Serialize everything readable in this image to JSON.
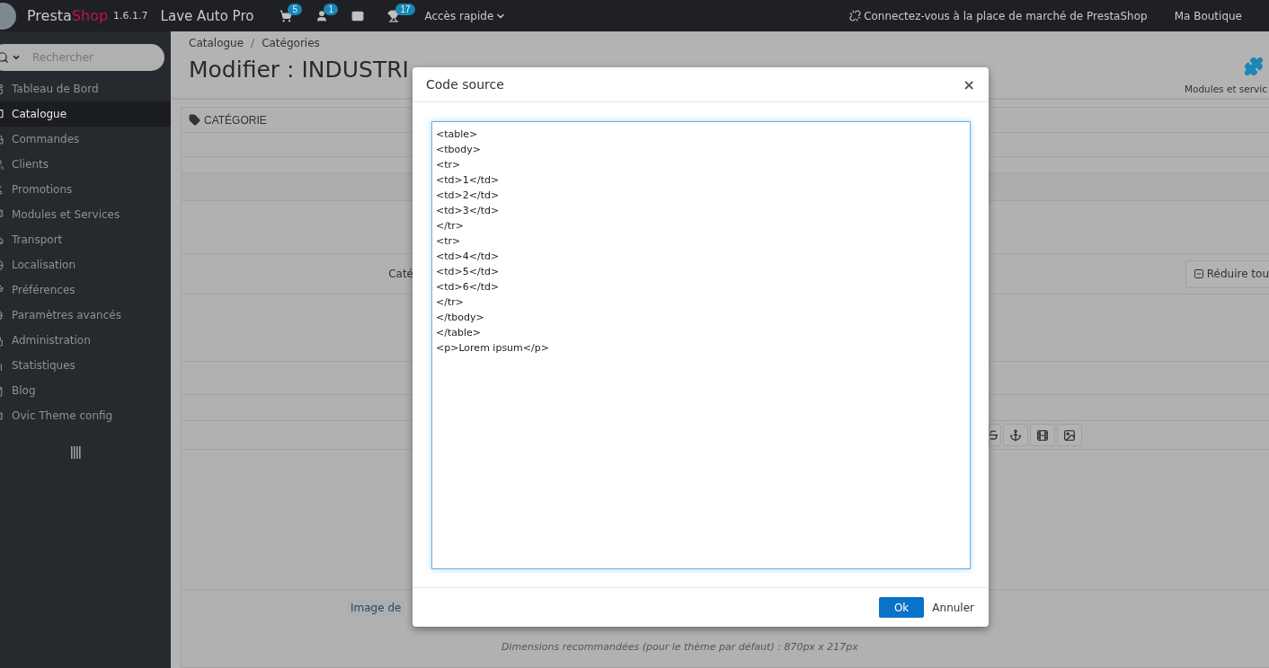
{
  "topbar": {
    "brand_main": "Presta",
    "brand_accent": "Shop",
    "version": "1.6.1.7",
    "shop_name": "Lave Auto Pro",
    "notifications": [
      {
        "kind": "cart",
        "count": "5"
      },
      {
        "kind": "customer",
        "count": "1"
      },
      {
        "kind": "message"
      },
      {
        "kind": "trophy",
        "count": "17"
      }
    ],
    "quick_access": "Accès rapide",
    "marketplace_link": "Connectez-vous à la place de marché de PrestaShop",
    "shop_link": "Ma Boutique"
  },
  "sidebar": {
    "search": {
      "placeholder": "Rechercher"
    },
    "items": [
      {
        "label": "Tableau de Bord",
        "selected": false
      },
      {
        "label": "Catalogue",
        "selected": true
      },
      {
        "label": "Commandes",
        "selected": false
      },
      {
        "label": "Clients",
        "selected": false
      },
      {
        "label": "Promotions",
        "selected": false
      },
      {
        "label": "Modules et Services",
        "selected": false
      },
      {
        "label": "Transport",
        "selected": false
      },
      {
        "label": "Localisation",
        "selected": false
      },
      {
        "label": "Préférences",
        "selected": false
      },
      {
        "label": "Paramètres avancés",
        "selected": false
      },
      {
        "label": "Administration",
        "selected": false
      },
      {
        "label": "Statistiques",
        "selected": false
      },
      {
        "label": "Blog",
        "selected": false
      },
      {
        "label": "Ovic Theme config",
        "selected": false
      }
    ]
  },
  "page": {
    "breadcrumb": [
      "Catalogue",
      "Catégories"
    ],
    "breadcrumb_separator": "/",
    "title": "Modifier : INDUSTRI",
    "toolbar_button": "Modules et servic"
  },
  "panel": {
    "heading": "CATÉGORIE",
    "field_label": "Caté",
    "collapse_button": "Réduire tou",
    "image_label": "Image de",
    "hint": "Dimensions recommandées (pour le thème par défaut) : 870px x 217px"
  },
  "modal": {
    "title": "Code source",
    "close": "×",
    "code": [
      "<table>",
      "<tbody>",
      "<tr>",
      "<td>1</td>",
      "<td>2</td>",
      "<td>3</td>",
      "</tr>",
      "<tr>",
      "<td>4</td>",
      "<td>5</td>",
      "<td>6</td>",
      "</tr>",
      "</tbody>",
      "</table>",
      "<p>Lorem ipsum</p>"
    ],
    "buttons": [
      {
        "label": "Ok",
        "kind": "primary"
      },
      {
        "label": "Annuler",
        "kind": "plain"
      }
    ]
  }
}
